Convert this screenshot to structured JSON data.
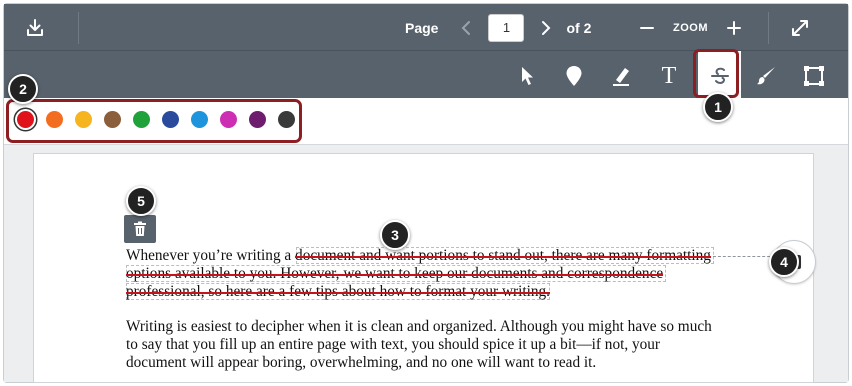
{
  "toolbar": {
    "page_label": "Page",
    "current_page": "1",
    "of_pages": "of 2",
    "zoom_label": "ZOOM",
    "icons": [
      "download-icon",
      "chevron-left-icon",
      "chevron-right-icon",
      "minus-icon",
      "plus-icon",
      "expand-icon"
    ]
  },
  "annotation_tools": [
    {
      "name": "select-tool",
      "icon": "cursor-icon"
    },
    {
      "name": "point-tool",
      "icon": "map-pin-icon"
    },
    {
      "name": "highlight-tool",
      "icon": "highlighter-icon"
    },
    {
      "name": "text-tool",
      "icon": "text-T-icon",
      "label": "T"
    },
    {
      "name": "strikeout-tool",
      "icon": "strikethrough-icon",
      "active": true
    },
    {
      "name": "draw-tool",
      "icon": "brush-icon"
    },
    {
      "name": "area-tool",
      "icon": "area-select-icon"
    }
  ],
  "colors": [
    {
      "name": "red",
      "hex": "#e0121c",
      "selected": true
    },
    {
      "name": "orange",
      "hex": "#f36d21"
    },
    {
      "name": "yellow",
      "hex": "#f6b51f"
    },
    {
      "name": "brown",
      "hex": "#8b5e3c"
    },
    {
      "name": "green",
      "hex": "#20a23a"
    },
    {
      "name": "navy",
      "hex": "#2a4b9b"
    },
    {
      "name": "blue",
      "hex": "#1e94dc"
    },
    {
      "name": "magenta",
      "hex": "#cc2fb3"
    },
    {
      "name": "purple",
      "hex": "#6e1c6e"
    },
    {
      "name": "charcoal",
      "hex": "#3a3a3a"
    }
  ],
  "document": {
    "para1": {
      "line1_plain": "Whenever you’re writing a ",
      "line1_struck": "document and want portions to stand out, there are many formatting",
      "line2_struck": "options available to you. However, we want to keep our documents and correspondence",
      "line3_struck": "professional, so here are a few tips about how to format your writing."
    },
    "para2": {
      "line1": "Writing is easiest to decipher when it is clean and organized. Although you might have so much",
      "line2": "to say that you fill up an entire page with text, you should spice it up a bit—if not, your",
      "line3": "document will appear boring, overwhelming, and no one will want to read it."
    }
  },
  "callouts": [
    "1",
    "2",
    "3",
    "4",
    "5"
  ],
  "accent_colors": {
    "toolbar": "#58626d",
    "highlight_border": "#8d1e22",
    "strike": "#c3161c"
  }
}
